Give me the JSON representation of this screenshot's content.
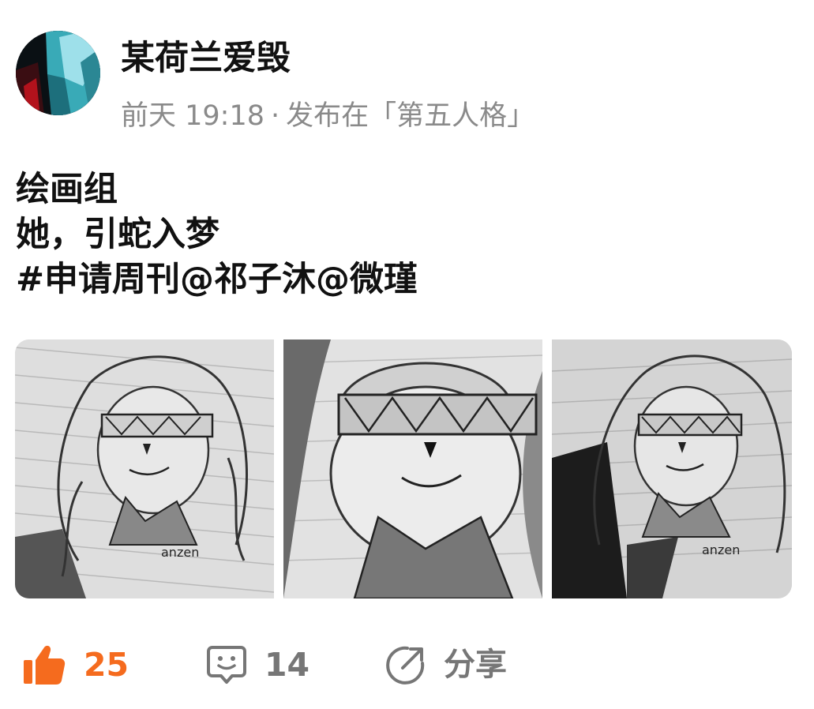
{
  "post": {
    "author": "某荷兰爱毁",
    "time": "前天 19:18",
    "separator": "·",
    "published_in": "发布在「第五人格」",
    "lines": [
      "绘画组",
      "她，引蛇入梦",
      "#申请周刊@祁子沐@微瑾"
    ],
    "images": [
      {
        "icon": "pencil-sketch-portrait"
      },
      {
        "icon": "pencil-sketch-portrait-closeup"
      },
      {
        "icon": "pencil-sketch-portrait-shadow"
      }
    ]
  },
  "actions": {
    "like_count": "25",
    "comment_count": "14",
    "share_label": "分享"
  },
  "colors": {
    "accent": "#f56b1e",
    "muted": "#8a8a8a",
    "icon_gray": "#767676"
  }
}
